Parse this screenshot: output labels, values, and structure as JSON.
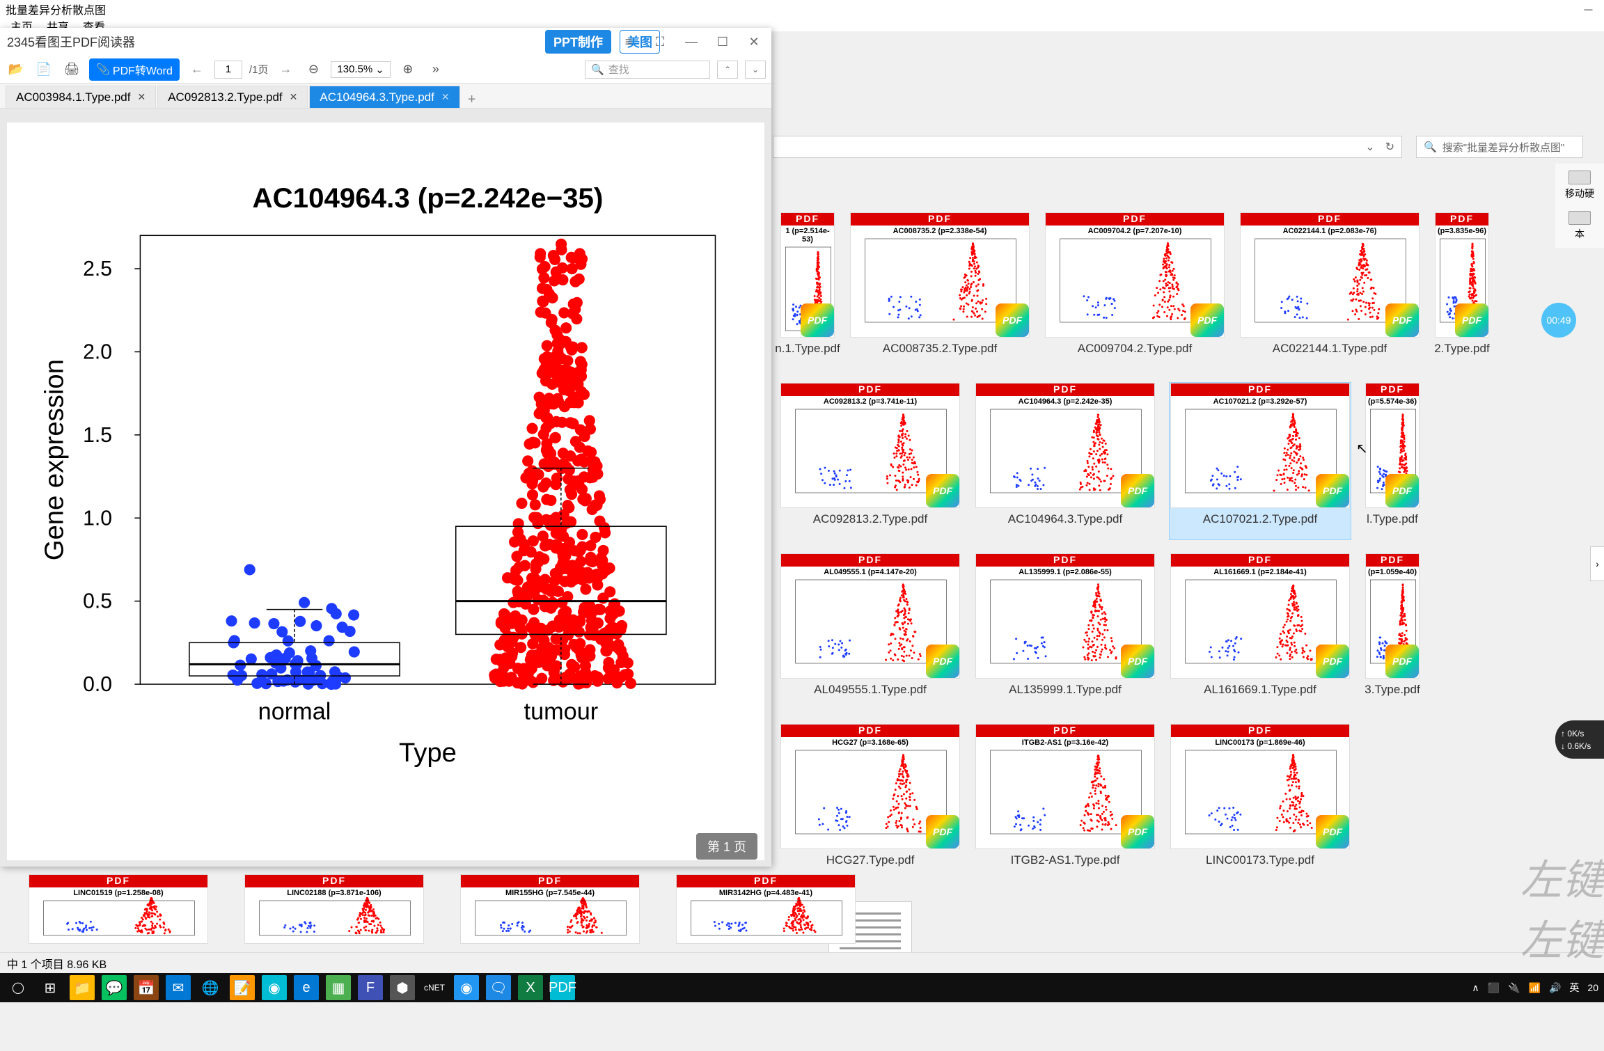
{
  "explorer": {
    "title": "批量差异分析散点图",
    "menu": [
      "主页",
      "共享",
      "查看"
    ],
    "breadcrumb_refresh": "↻",
    "search_placeholder": "搜索\"批量差异分析散点图\"",
    "status": "中 1 个项目  8.96 KB"
  },
  "pdf_reader": {
    "app_name": "2345看图王PDF阅读器",
    "ppt_button": "PPT制作",
    "meitu_button": "美图",
    "pdf_to_word": "PDF转Word",
    "page_current": "1",
    "page_total": "/1页",
    "zoom": "130.5%",
    "search_placeholder": "查找",
    "page_indicator": "第  1  页",
    "tabs": [
      {
        "label": "AC003984.1.Type.pdf",
        "active": false
      },
      {
        "label": "AC092813.2.Type.pdf",
        "active": false
      },
      {
        "label": "AC104964.3.Type.pdf",
        "active": true
      }
    ]
  },
  "chart_data": {
    "type": "scatter-box",
    "title": "AC104964.3 (p=2.242e−35)",
    "xlabel": "Type",
    "ylabel": "Gene expression",
    "categories": [
      "normal",
      "tumour"
    ],
    "y_ticks": [
      0.0,
      0.5,
      1.0,
      1.5,
      2.0,
      2.5
    ],
    "ylim": [
      0.0,
      2.7
    ],
    "series": [
      {
        "name": "normal",
        "color": "#1e3cff",
        "box": {
          "q1": 0.05,
          "median": 0.12,
          "q3": 0.25,
          "whisker_low": 0.0,
          "whisker_high": 0.45
        },
        "n_points": 60,
        "range": [
          0.0,
          0.85
        ]
      },
      {
        "name": "tumour",
        "color": "#ff0000",
        "box": {
          "q1": 0.3,
          "median": 0.5,
          "q3": 0.95,
          "whisker_low": 0.0,
          "whisker_high": 1.3
        },
        "n_points": 520,
        "range": [
          0.0,
          2.65
        ]
      }
    ]
  },
  "files": [
    {
      "name": "n.1.Type.pdf",
      "title": "1 (p=2.514e-53)",
      "partial": true
    },
    {
      "name": "AC008735.2.Type.pdf",
      "title": "AC008735.2 (p=2.338e-54)"
    },
    {
      "name": "AC009704.2.Type.pdf",
      "title": "AC009704.2 (p=7.207e-10)"
    },
    {
      "name": "AC022144.1.Type.pdf",
      "title": "AC022144.1 (p=2.083e-76)"
    },
    {
      "name": "2.Type.pdf",
      "title": "(p=3.835e-96)",
      "partial": true
    },
    {
      "name": "AC092813.2.Type.pdf",
      "title": "AC092813.2 (p=3.741e-11)"
    },
    {
      "name": "AC104964.3.Type.pdf",
      "title": "AC104964.3 (p=2.242e-35)"
    },
    {
      "name": "AC107021.2.Type.pdf",
      "title": "AC107021.2 (p=3.292e-57)",
      "selected": true
    },
    {
      "name": "l.Type.pdf",
      "title": "(p=5.574e-36)",
      "partial": true
    },
    {
      "name": "AL049555.1.Type.pdf",
      "title": "AL049555.1 (p=4.147e-20)"
    },
    {
      "name": "AL135999.1.Type.pdf",
      "title": "AL135999.1 (p=2.086e-55)"
    },
    {
      "name": "AL161669.1.Type.pdf",
      "title": "AL161669.1 (p=2.184e-41)"
    },
    {
      "name": "3.Type.pdf",
      "title": "(p=1.059e-40)",
      "partial": true
    },
    {
      "name": "HCG27.Type.pdf",
      "title": "HCG27 (p=3.168e-65)"
    },
    {
      "name": "ITGB2-AS1.Type.pdf",
      "title": "ITGB2-AS1 (p=3.16e-42)"
    },
    {
      "name": "LINC00173.Type.pdf",
      "title": "LINC00173 (p=1.869e-46)"
    }
  ],
  "bottom_files": [
    {
      "name": "",
      "title": "LINC01519 (p=1.258e-08)",
      "pdf_label": "PDF"
    },
    {
      "name": "",
      "title": "LINC02188 (p=3.871e-106)",
      "pdf_label": "PDF"
    },
    {
      "name": "",
      "title": "MIR155HG (p=7.545e-44)",
      "pdf_label": "PDF"
    },
    {
      "name": "",
      "title": "MIR3142HG (p=4.483e-41)",
      "pdf_label": "PDF"
    }
  ],
  "text_file": "",
  "right_panel": {
    "item1": "移动硬",
    "item2": "本"
  },
  "timer": "00:49",
  "net": {
    "up": "0K/s",
    "down": "0.6K/s"
  },
  "watermark": "左键",
  "taskbar": {
    "tray": [
      "∧",
      "⬛",
      "🔌",
      "📶",
      "🔊"
    ],
    "ime": "英",
    "date": "20"
  },
  "labels": {
    "pdf_banner": "PDF",
    "pdf_badge": "PDF"
  }
}
